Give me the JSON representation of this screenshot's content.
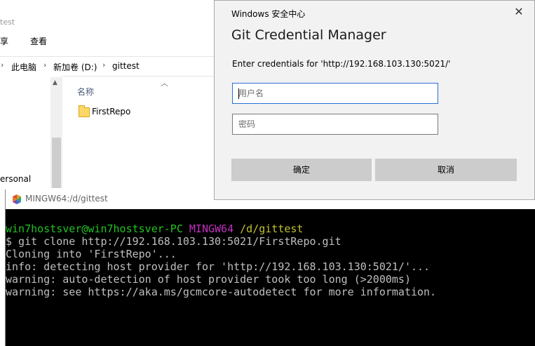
{
  "explorer": {
    "title_fragment": "test",
    "menu": [
      "享",
      "查看"
    ],
    "breadcrumb": [
      "此电脑",
      "新加卷 (D:)",
      "gittest"
    ],
    "column_header": "名称",
    "files": [
      {
        "name": "FirstRepo",
        "icon": "folder-icon"
      }
    ],
    "nav_partial": "ersonal"
  },
  "terminal": {
    "title": "MINGW64:/d/gittest",
    "prompt": {
      "user_host": "win7hostsver@win7hostsver-PC",
      "env": "MINGW64",
      "path": "/d/gittest"
    },
    "lines": [
      "$ git clone http://192.168.103.130:5021/FirstRepo.git",
      "Cloning into 'FirstRepo'...",
      "info: detecting host provider for 'http://192.168.103.130:5021/'...",
      "warning: auto-detection of host provider took too long (>2000ms)",
      "warning: see https://aka.ms/gcmcore-autodetect for more information."
    ],
    "colors": {
      "user_host": "#21c421",
      "env": "#c030c0",
      "path": "#c0c030",
      "text": "#bfbfbf",
      "bg": "#000000"
    }
  },
  "dialog": {
    "window_title": "Windows 安全中心",
    "heading": "Git Credential Manager",
    "message": "Enter credentials for 'http://192.168.103.130:5021/'",
    "username_placeholder": "用户名",
    "password_placeholder": "密码",
    "ok_label": "确定",
    "cancel_label": "取消",
    "close_glyph": "✕"
  }
}
